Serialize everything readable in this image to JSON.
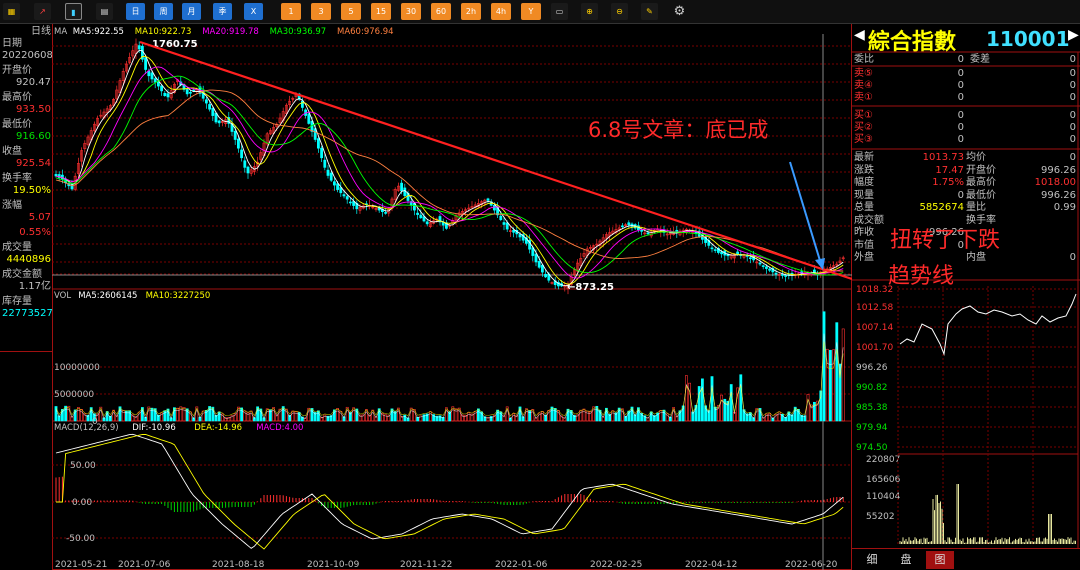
{
  "toolbar": {
    "blue_buttons": [
      "日",
      "周",
      "月",
      "季",
      "X"
    ],
    "orange_buttons": [
      "1",
      "3",
      "5",
      "15",
      "30",
      "60",
      "2h",
      "4h",
      "Y"
    ]
  },
  "left_panel": {
    "period": "日线",
    "items": [
      {
        "label": "日期",
        "value": "20220608",
        "color": "#c0c0c0"
      },
      {
        "label": "开盘价",
        "value": "920.47",
        "color": "#c0c0c0"
      },
      {
        "label": "最高价",
        "value": "933.50",
        "color": "#ff3030"
      },
      {
        "label": "最低价",
        "value": "916.60",
        "color": "#00e000"
      },
      {
        "label": "收盘",
        "value": "925.54",
        "color": "#ff3030"
      },
      {
        "label": "换手率",
        "value": "19.50%",
        "color": "#ffff00"
      },
      {
        "label": "涨幅",
        "value": "5.07",
        "color": "#ff3030"
      },
      {
        "label": "",
        "value": "0.55%",
        "color": "#ff3030"
      },
      {
        "label": "成交量",
        "value": "4440896",
        "color": "#ffff00"
      },
      {
        "label": "成交金额",
        "value": "1.17亿",
        "color": "#c0c0c0"
      },
      {
        "label": "库存量",
        "value": "22773527",
        "color": "#00ffff"
      }
    ]
  },
  "ma_legend": [
    {
      "text": "MA",
      "color": "#c0c0c0"
    },
    {
      "text": "MA5:922.55",
      "color": "#ffffff"
    },
    {
      "text": "MA10:922.73",
      "color": "#ffff00"
    },
    {
      "text": "MA20:919.78",
      "color": "#ff00ff"
    },
    {
      "text": "MA30:936.97",
      "color": "#00ff00"
    },
    {
      "text": "MA60:976.94",
      "color": "#ff8040"
    }
  ],
  "vol_legend": [
    {
      "text": "VOL",
      "color": "#c0c0c0"
    },
    {
      "text": "MA5:2606145",
      "color": "#ffffff"
    },
    {
      "text": "MA10:3227250",
      "color": "#ffff00"
    }
  ],
  "macd_legend": [
    {
      "text": "MACD(12,26,9)",
      "color": "#c0c0c0"
    },
    {
      "text": "DIF:-10.96",
      "color": "#ffffff"
    },
    {
      "text": "DEA:-14.96",
      "color": "#ffff00"
    },
    {
      "text": "MACD:4.00",
      "color": "#ff00ff"
    }
  ],
  "price_labels": {
    "high": "1760.75",
    "low": "873.25"
  },
  "vol_axis": [
    "10000000",
    "5000000",
    "0"
  ],
  "macd_axis": [
    "50.00",
    "0.00",
    "-50.00"
  ],
  "date_axis": [
    "2021-05-21",
    "2021-07-06",
    "2021-08-18",
    "2021-10-09",
    "2021-11-22",
    "2022-01-06",
    "2022-02-25",
    "2022-04-12",
    "2022-06-20"
  ],
  "annotations": {
    "article": "6.8号文章：底已成",
    "trend_line1": "扭转了下跌",
    "trend_line2": "趋势线"
  },
  "quote": {
    "title": "綜合指數",
    "code": "110001",
    "book": [
      {
        "label": "委比",
        "value": "0",
        "label2": "委差",
        "value2": "0"
      },
      {
        "label": "卖⑤",
        "value": "0",
        "value2": "0"
      },
      {
        "label": "卖④",
        "value": "0",
        "value2": "0"
      },
      {
        "label": "卖①",
        "value": "0",
        "value2": "0"
      },
      {
        "label": "买①",
        "value": "0",
        "value2": "0"
      },
      {
        "label": "买②",
        "value": "0",
        "value2": "0"
      },
      {
        "label": "买③",
        "value": "0",
        "value2": "0"
      }
    ],
    "stats": [
      {
        "l1": "最新",
        "v1": "1013.73",
        "c1": "#ff3030",
        "l2": "均价",
        "v2": "0",
        "c2": "#c0c0c0"
      },
      {
        "l1": "涨跌",
        "v1": "17.47",
        "c1": "#ff3030",
        "l2": "开盘价",
        "v2": "996.26",
        "c2": "#c0c0c0"
      },
      {
        "l1": "幅度",
        "v1": "1.75%",
        "c1": "#ff3030",
        "l2": "最高价",
        "v2": "1018.00",
        "c2": "#ff3030"
      },
      {
        "l1": "现量",
        "v1": "0",
        "c1": "#c0c0c0",
        "l2": "最低价",
        "v2": "996.26",
        "c2": "#c0c0c0"
      },
      {
        "l1": "总量",
        "v1": "5852674",
        "c1": "#ffff00",
        "l2": "量比",
        "v2": "0.99",
        "c2": "#c0c0c0"
      },
      {
        "l1": "成交额",
        "v1": "",
        "c1": "#c0c0c0",
        "l2": "换手率",
        "v2": "",
        "c2": "#c0c0c0"
      },
      {
        "l1": "昨收",
        "v1": "996.26",
        "c1": "#c0c0c0",
        "l2": "",
        "v2": "",
        "c2": "#c0c0c0"
      },
      {
        "l1": "市值",
        "v1": "0",
        "c1": "#c0c0c0",
        "l2": "",
        "v2": "",
        "c2": "#c0c0c0"
      },
      {
        "l1": "外盘",
        "v1": "",
        "c1": "#c0c0c0",
        "l2": "内盘",
        "v2": "0",
        "c2": "#c0c0c0"
      }
    ],
    "intraday_axis": [
      "1018.32",
      "1012.58",
      "1007.14",
      "1001.70",
      "996.26",
      "990.82",
      "985.38",
      "979.94",
      "974.50"
    ],
    "intraday_vol_axis": [
      "220807",
      "165606",
      "110404",
      "55202"
    ],
    "tabs": [
      "细",
      "盘",
      "图"
    ]
  },
  "colors": {
    "up": "#ff3030",
    "down": "#00ffff",
    "frame": "#a01010",
    "trend": "#ff2020",
    "arrow": "#3a9aff"
  }
}
